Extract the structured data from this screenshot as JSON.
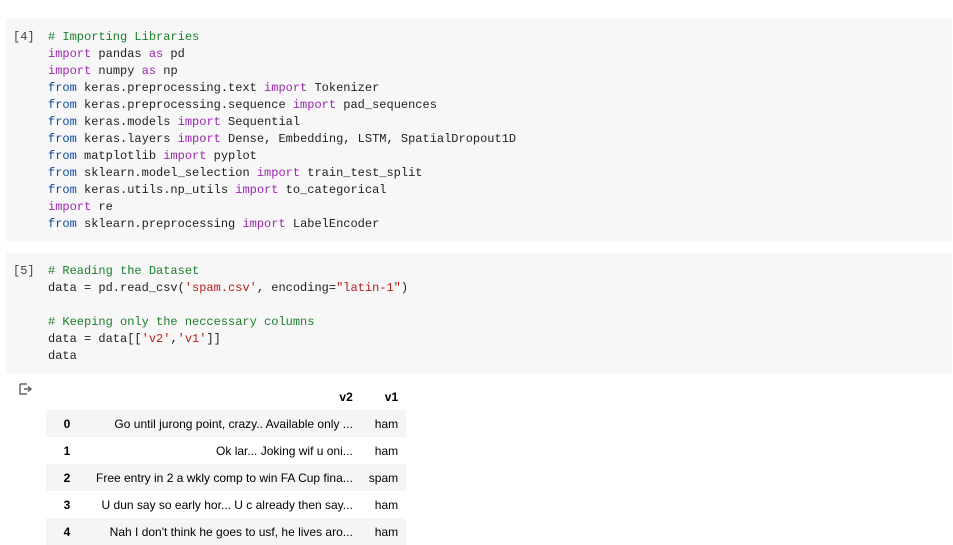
{
  "cells": [
    {
      "count": "[4]",
      "lines": [
        [
          {
            "t": "# Importing Libraries",
            "c": "cm"
          }
        ],
        [
          {
            "t": "import",
            "c": "kw"
          },
          {
            "t": " pandas "
          },
          {
            "t": "as",
            "c": "kw"
          },
          {
            "t": " pd"
          }
        ],
        [
          {
            "t": "import",
            "c": "kw"
          },
          {
            "t": " numpy "
          },
          {
            "t": "as",
            "c": "kw"
          },
          {
            "t": " np"
          }
        ],
        [
          {
            "t": "from",
            "c": "fr"
          },
          {
            "t": " keras.preprocessing.text "
          },
          {
            "t": "import",
            "c": "kw"
          },
          {
            "t": " Tokenizer"
          }
        ],
        [
          {
            "t": "from",
            "c": "fr"
          },
          {
            "t": " keras.preprocessing.sequence "
          },
          {
            "t": "import",
            "c": "kw"
          },
          {
            "t": " pad_sequences"
          }
        ],
        [
          {
            "t": "from",
            "c": "fr"
          },
          {
            "t": " keras.models "
          },
          {
            "t": "import",
            "c": "kw"
          },
          {
            "t": " Sequential"
          }
        ],
        [
          {
            "t": "from",
            "c": "fr"
          },
          {
            "t": " keras.layers "
          },
          {
            "t": "import",
            "c": "kw"
          },
          {
            "t": " Dense, Embedding, LSTM, SpatialDropout1D"
          }
        ],
        [
          {
            "t": "from",
            "c": "fr"
          },
          {
            "t": " matplotlib "
          },
          {
            "t": "import",
            "c": "kw"
          },
          {
            "t": " pyplot"
          }
        ],
        [
          {
            "t": "from",
            "c": "fr"
          },
          {
            "t": " sklearn.model_selection "
          },
          {
            "t": "import",
            "c": "kw"
          },
          {
            "t": " train_test_split"
          }
        ],
        [
          {
            "t": "from",
            "c": "fr"
          },
          {
            "t": " keras.utils.np_utils "
          },
          {
            "t": "import",
            "c": "kw"
          },
          {
            "t": " to_categorical"
          }
        ],
        [
          {
            "t": "import",
            "c": "kw"
          },
          {
            "t": " re"
          }
        ],
        [
          {
            "t": "from",
            "c": "fr"
          },
          {
            "t": " sklearn.preprocessing "
          },
          {
            "t": "import",
            "c": "kw"
          },
          {
            "t": " LabelEncoder"
          }
        ]
      ]
    },
    {
      "count": "[5]",
      "lines": [
        [
          {
            "t": "# Reading the Dataset",
            "c": "cm"
          }
        ],
        [
          {
            "t": "data = pd.read_csv("
          },
          {
            "t": "'spam.csv'",
            "c": "st"
          },
          {
            "t": ", encoding="
          },
          {
            "t": "\"latin-1\"",
            "c": "st"
          },
          {
            "t": ")"
          }
        ],
        [],
        [
          {
            "t": "# Keeping only the neccessary columns",
            "c": "cm"
          }
        ],
        [
          {
            "t": "data = data[["
          },
          {
            "t": "'v2'",
            "c": "st"
          },
          {
            "t": ","
          },
          {
            "t": "'v1'",
            "c": "st"
          },
          {
            "t": "]]"
          }
        ],
        [
          {
            "t": "data"
          }
        ]
      ]
    }
  ],
  "output": {
    "icon": "output-redirect-icon",
    "columns": [
      "v2",
      "v1"
    ],
    "rows": [
      {
        "index": "0",
        "v2": "Go until jurong point, crazy.. Available only ...",
        "v1": "ham"
      },
      {
        "index": "1",
        "v2": "Ok lar... Joking wif u oni...",
        "v1": "ham"
      },
      {
        "index": "2",
        "v2": "Free entry in 2 a wkly comp to win FA Cup fina...",
        "v1": "spam"
      },
      {
        "index": "3",
        "v2": "U dun say so early hor... U c already then say...",
        "v1": "ham"
      },
      {
        "index": "4",
        "v2": "Nah I don't think he goes to usf, he lives aro...",
        "v1": "ham"
      }
    ]
  }
}
